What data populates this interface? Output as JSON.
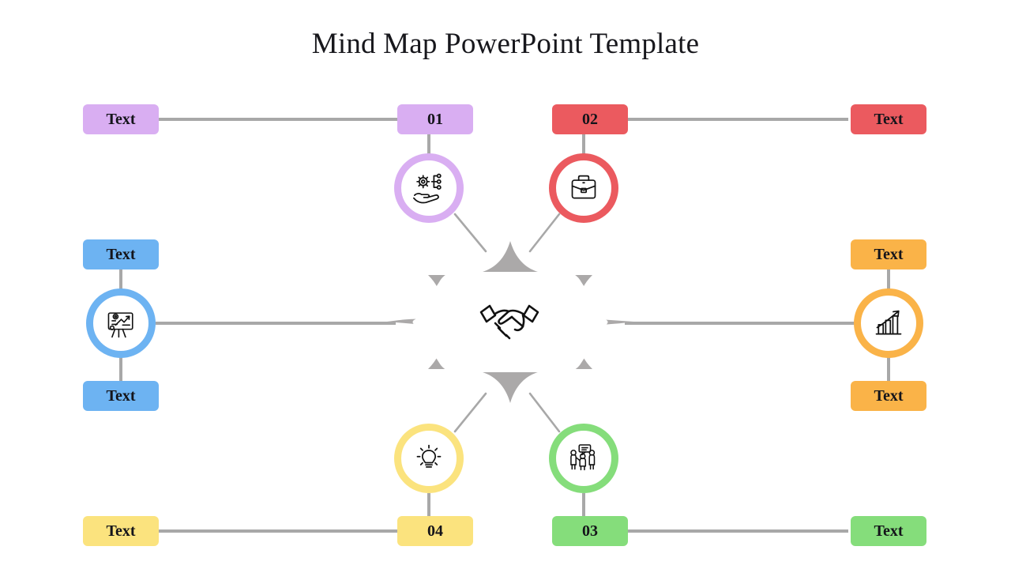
{
  "page": {
    "title": "Mind Map PowerPoint Template",
    "background_color": "#FFFFFF",
    "connector_color": "#A8A8A8",
    "hub_color": "#ABA9A9"
  },
  "center": {
    "icon": "handshake-icon",
    "shape": "six-pointed-star",
    "fill": "#ABA9A9",
    "inner_fill": "#FFFFFF"
  },
  "nodes": [
    {
      "id": "01",
      "number": "01",
      "text": "Text",
      "color": "#D9AEF2",
      "icon": "hand-gear-icon",
      "position": "top-left"
    },
    {
      "id": "02",
      "number": "02",
      "text": "Text",
      "color": "#EB5A5F",
      "icon": "briefcase-icon",
      "position": "top-right"
    },
    {
      "id": "03",
      "number": "03",
      "text": "Text",
      "color": "#85DD7B",
      "icon": "team-meeting-icon",
      "position": "bottom-right"
    },
    {
      "id": "04",
      "number": "04",
      "text": "Text",
      "color": "#FBE37E",
      "icon": "lightbulb-icon",
      "position": "bottom-left"
    },
    {
      "id": "left",
      "number": "",
      "text_top": "Text",
      "text_bottom": "Text",
      "color": "#6DB3F2",
      "icon": "presentation-chart-icon",
      "position": "middle-left"
    },
    {
      "id": "right",
      "number": "",
      "text_top": "Text",
      "text_bottom": "Text",
      "color": "#FAB348",
      "icon": "growth-bar-chart-icon",
      "position": "middle-right"
    }
  ],
  "labels": {
    "top_left_text": "Text",
    "top_left_num": "01",
    "top_right_num": "02",
    "top_right_text": "Text",
    "mid_left_text_top": "Text",
    "mid_left_text_bottom": "Text",
    "mid_right_text_top": "Text",
    "mid_right_text_bottom": "Text",
    "bottom_left_text": "Text",
    "bottom_left_num": "04",
    "bottom_right_num": "03",
    "bottom_right_text": "Text"
  }
}
